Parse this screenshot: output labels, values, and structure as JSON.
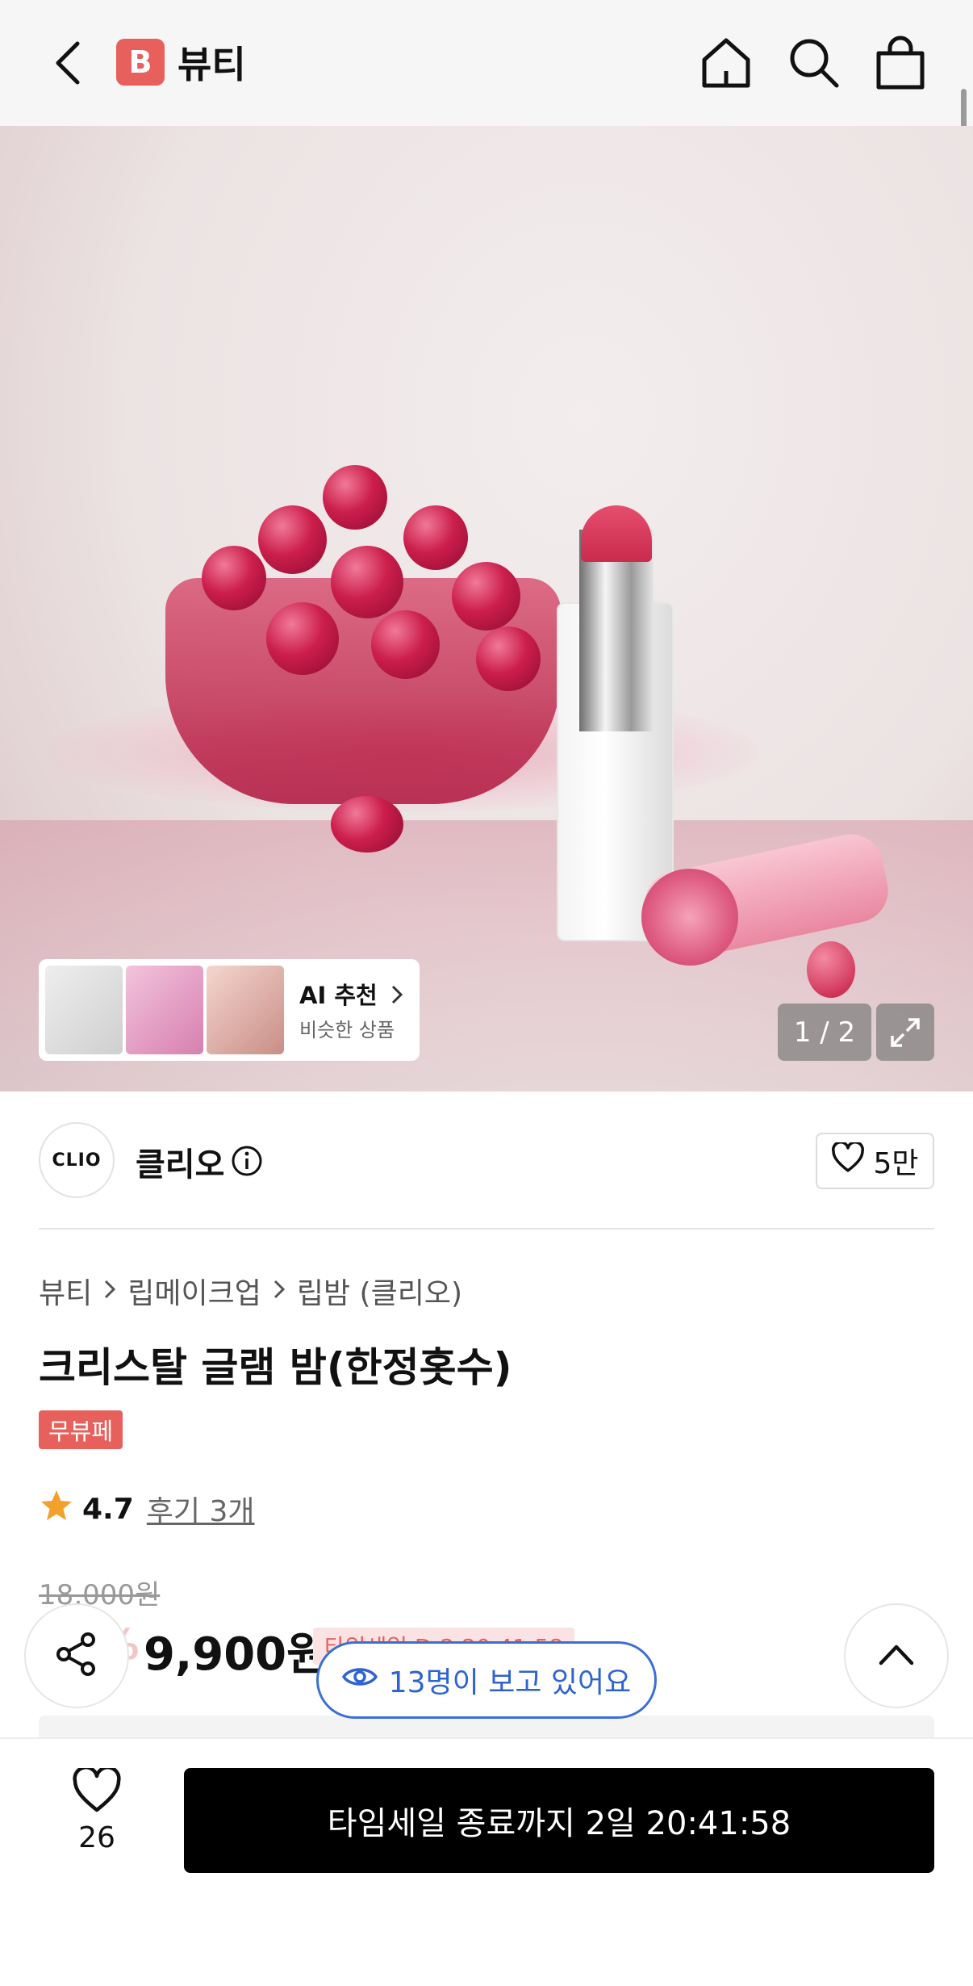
{
  "header": {
    "logo_letter": "B",
    "title": "뷰티",
    "icons": [
      "back-icon",
      "home-icon",
      "search-icon",
      "shopping-bag-icon"
    ]
  },
  "gallery": {
    "ai_card": {
      "title": "AI 추천",
      "subtitle": "비슷한 상품"
    },
    "pager": "1 / 2"
  },
  "brand": {
    "logo_text": "CLIO",
    "name": "클리오",
    "likes": "5만"
  },
  "breadcrumb": [
    "뷰티",
    "립메이크업",
    "립밤 (클리오)"
  ],
  "product": {
    "title": "크리스탈 글램 밤(한정홋수)",
    "tag": "무뷰페",
    "rating": "4.7",
    "reviews": "후기 3개",
    "original_price": "18,000원",
    "discount": "45%",
    "price": "9,900원",
    "sale_chip": "타임세일 D-2 20:41:58"
  },
  "viewers": "13명이 보고 있어요",
  "bottom": {
    "wish_count": "26",
    "cta": "타임세일 종료까지 2일 20:41:58"
  },
  "colors": {
    "brand_red": "#e8605c",
    "viewer_blue": "#2f63d0",
    "cta_bg": "#000000"
  }
}
